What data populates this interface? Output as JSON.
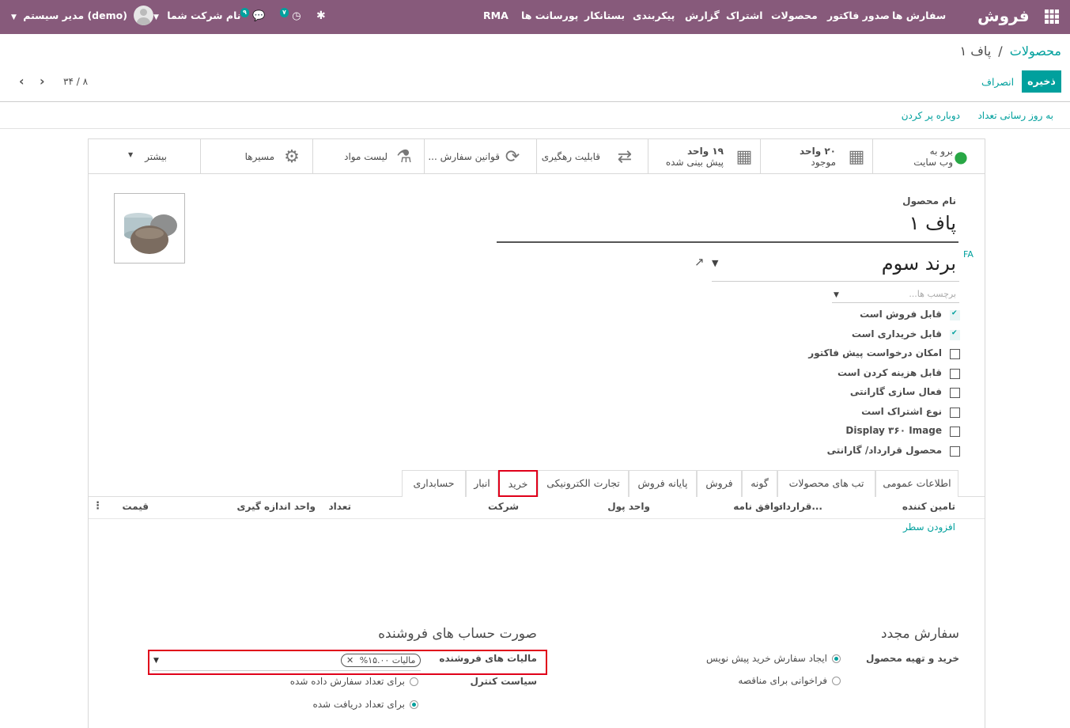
{
  "navbar": {
    "app_name": "فروش",
    "menu": [
      "سفارش ها",
      "صدور فاکتور",
      "محصولات",
      "اشتراک",
      "گزارش",
      "پیکربندی",
      "بستانکار",
      "پورسانت ها",
      "RMA"
    ],
    "messages_count": "۹",
    "activities_count": "۷",
    "company": "نام شرکت شما",
    "user": "مدیر سیستم (demo)"
  },
  "breadcrumb": {
    "parent": "محصولات",
    "separator": "/",
    "current": "پاف ۱"
  },
  "actions": {
    "save": "ذخیره",
    "discard": "انصراف"
  },
  "pager": {
    "value": "۸ / ۳۴"
  },
  "header_buttons": {
    "update_qty": "به روز رسانی تعداد",
    "replenish": "دوباره پر کردن"
  },
  "smart_buttons": {
    "website_l1": "برو به",
    "website_l2": "وب سایت",
    "onhand_l1": "۲۰ واحد",
    "onhand_l2": "موجود",
    "forecast_l1": "۱۹ واحد",
    "forecast_l2": "پیش بینی شده",
    "traceability": "قابلیت رهگیری",
    "order_rules": "قوانین سفارش ...",
    "bom": "لیست مواد",
    "routes": "مسیرها",
    "more": "بیشتر"
  },
  "form": {
    "name_label": "نام محصول",
    "name": "پاف ۱",
    "lang": "FA",
    "brand": "برند سوم",
    "tags_placeholder": "برچسب ها...",
    "checkboxes": [
      {
        "label": "قابل فروش است",
        "checked": true
      },
      {
        "label": "قابل خریداری است",
        "checked": true
      },
      {
        "label": "امکان درخواست پیش فاکتور",
        "checked": false
      },
      {
        "label": "قابل هزینه کردن است",
        "checked": false
      },
      {
        "label": "فعال سازی گارانتی",
        "checked": false
      },
      {
        "label": "نوع اشتراک است",
        "checked": false
      },
      {
        "label": "Display ۳۶۰ Image",
        "checked": false
      },
      {
        "label": "محصول قرارداد/ گارانتی",
        "checked": false
      }
    ]
  },
  "tabs": [
    "اطلاعات عمومی",
    "تب های محصولات",
    "گونه",
    "فروش",
    "پایانه فروش",
    "تجارت الکترونیکی",
    "خرید",
    "انبار",
    "حسابداری"
  ],
  "active_tab": "خرید",
  "vendor_table": {
    "columns": [
      "تامین کننده",
      "قرارداد...",
      "توافق نامه",
      "واحد پول",
      "شرکت",
      "تعداد",
      "واحد اندازه گیری",
      "قیمت"
    ],
    "add_line": "افزودن سطر"
  },
  "reordering": {
    "title": "سفارش مجدد",
    "buy_label": "خرید و تهیه محصول",
    "opt1": "ایجاد سفارش خرید پیش نویس",
    "opt2": "فراخوانی برای مناقصه"
  },
  "vendor_bills": {
    "title": "صورت حساب های فروشنده",
    "taxes_label": "مالیات های فروشنده",
    "tax_tag": "مالیات ۱۵.۰۰%",
    "control_label": "سیاست کنترل",
    "ctrl1": "برای تعداد سفارش داده شده",
    "ctrl2": "برای تعداد دریافت شده"
  },
  "colors": {
    "primary": "#875a7b",
    "accent": "#00a09d",
    "highlight": "#e0001a"
  }
}
